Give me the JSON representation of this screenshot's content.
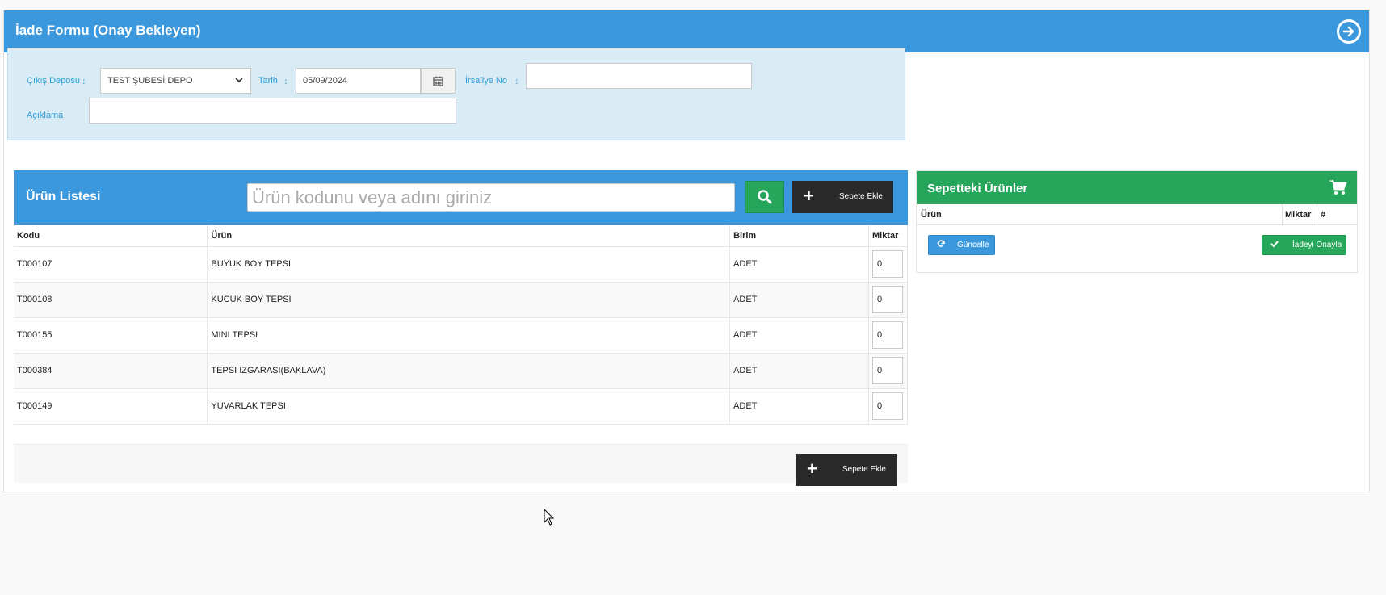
{
  "page": {
    "title": "İade Formu (Onay Bekleyen)",
    "header_icon": "arrow-circle-right-icon"
  },
  "form": {
    "depot_label": "Çıkış Deposu",
    "depot_value": "TEST ŞUBESİ DEPO",
    "date_label": "Tarih",
    "date_value": "05/09/2024",
    "waybill_label": "İrsaliye No",
    "waybill_value": "",
    "description_label": "Açıklama",
    "description_value": "",
    "colon": ":"
  },
  "product_list": {
    "title": "Ürün Listesi",
    "search_placeholder": "Ürün kodunu veya adını giriniz",
    "add_to_cart_label": "Sepete Ekle",
    "columns": [
      "Kodu",
      "Ürün",
      "Birim",
      "Miktar"
    ],
    "rows": [
      {
        "code": "T000107",
        "name": "BUYUK BOY TEPSI",
        "unit": "ADET",
        "qty": "0"
      },
      {
        "code": "T000108",
        "name": "KUCUK BOY TEPSI",
        "unit": "ADET",
        "qty": "0"
      },
      {
        "code": "T000155",
        "name": "MINI TEPSI",
        "unit": "ADET",
        "qty": "0"
      },
      {
        "code": "T000384",
        "name": "TEPSI IZGARASI(BAKLAVA)",
        "unit": "ADET",
        "qty": "0"
      },
      {
        "code": "T000149",
        "name": "YUVARLAK TEPSI",
        "unit": "ADET",
        "qty": "0"
      }
    ],
    "footer_add_label": "Sepete Ekle"
  },
  "basket": {
    "title": "Sepetteki Ürünler",
    "columns": [
      "Ürün",
      "Miktar",
      "#"
    ],
    "update_label": "Güncelle",
    "approve_label": "İadeyi Onayla"
  },
  "colors": {
    "primary_blue": "#3b98dc",
    "success_green": "#26a65b",
    "dark": "#2a2a2a",
    "form_bg": "#d9ecf6",
    "label_blue": "#2a9bd6"
  }
}
